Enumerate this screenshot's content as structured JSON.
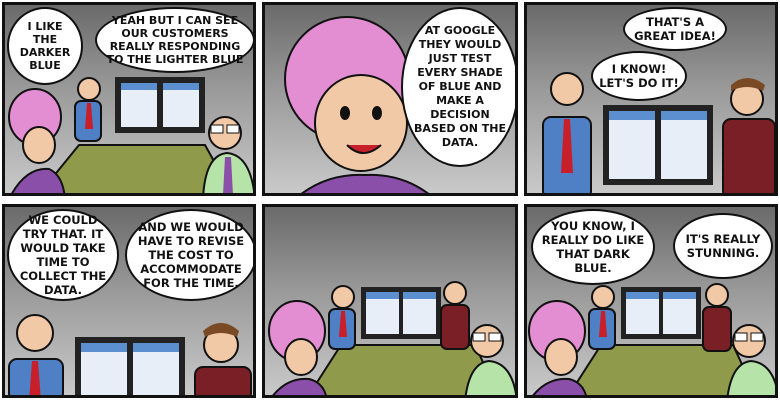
{
  "comic": {
    "panels": [
      {
        "id": "p1",
        "bubbles": [
          {
            "text": "I LIKE THE DARKER BLUE"
          },
          {
            "text": "YEAH BUT I CAN SEE OUR CUSTOMERS REALLY RESPONDING TO THE LIGHTER BLUE"
          }
        ]
      },
      {
        "id": "p2",
        "bubbles": [
          {
            "text": "AT GOOGLE THEY WOULD JUST TEST EVERY SHADE OF BLUE AND MAKE A DECISION BASED ON THE DATA."
          }
        ]
      },
      {
        "id": "p3",
        "bubbles": [
          {
            "text": "THAT'S A GREAT IDEA!"
          },
          {
            "text": "I KNOW! LET'S DO IT!"
          }
        ]
      },
      {
        "id": "p4",
        "bubbles": [
          {
            "text": "WE COULD TRY THAT. IT WOULD TAKE TIME TO COLLECT THE DATA."
          },
          {
            "text": "AND WE WOULD HAVE TO REVISE THE COST TO ACCOMMODATE FOR THE TIME."
          }
        ]
      },
      {
        "id": "p5",
        "bubbles": []
      },
      {
        "id": "p6",
        "bubbles": [
          {
            "text": "YOU KNOW, I REALLY DO LIKE THAT DARK BLUE."
          },
          {
            "text": "IT'S REALLY STUNNING."
          }
        ]
      }
    ]
  },
  "colors": {
    "ink": "#111111",
    "board_blue": "#5b8fcf",
    "table": "#8f9a4a",
    "pink_hair": "#e38ed3",
    "shirt_blue": "#4f7fc4",
    "tie_red": "#c8202a",
    "sweater_maroon": "#7a1f25",
    "shirt_green": "#b5e3a8",
    "dress_purple": "#8a4fa8"
  },
  "icons": [
    "comic-panel",
    "speech-bubble"
  ]
}
